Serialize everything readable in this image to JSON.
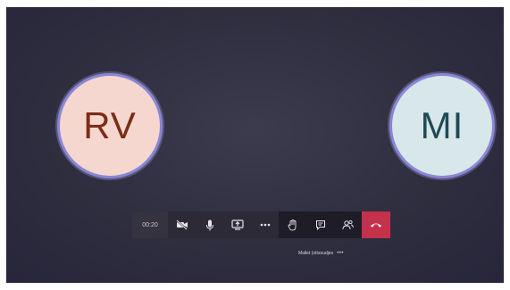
{
  "participants": [
    {
      "initials": "RV"
    },
    {
      "initials": "MI"
    }
  ],
  "toolbar": {
    "timer": "00:20",
    "buttons": [
      {
        "icon": "video-off-icon"
      },
      {
        "icon": "microphone-icon"
      },
      {
        "icon": "share-screen-icon"
      },
      {
        "icon": "more-options-icon"
      },
      {
        "icon": "raise-hand-icon"
      },
      {
        "icon": "chat-icon"
      },
      {
        "icon": "participants-icon"
      },
      {
        "icon": "hang-up-icon"
      }
    ]
  },
  "caption": {
    "text": "Mallet (ottsoudjes",
    "more": "•••"
  },
  "colors": {
    "stage": "#2f2e3f",
    "avatar_rv_bg": "#f6d7cf",
    "avatar_mi_bg": "#d8e7ea",
    "avatar_ring": "#8a86d6",
    "hangup": "#c4314b"
  }
}
